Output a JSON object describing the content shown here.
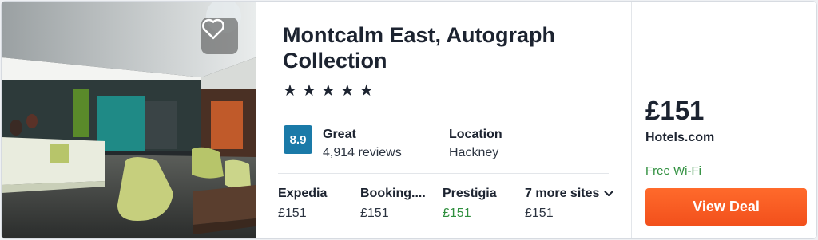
{
  "hotel": {
    "name": "Montcalm East, Autograph Collection",
    "star_count": 5,
    "star_glyph": "★",
    "rating_score": "8.9",
    "rating_label": "Great",
    "reviews": "4,914 reviews",
    "location_label": "Location",
    "location": "Hackney"
  },
  "sites": [
    {
      "name": "Expedia",
      "price": "£151",
      "highlight": false
    },
    {
      "name": "Booking....",
      "price": "£151",
      "highlight": false
    },
    {
      "name": "Prestigia",
      "price": "£151",
      "highlight": true
    },
    {
      "name": "7 more sites",
      "price": "£151",
      "highlight": false
    }
  ],
  "deal": {
    "price": "£151",
    "provider": "Hotels.com",
    "amenity": "Free Wi-Fi",
    "button_label": "View Deal"
  },
  "icons": {
    "favorite": "heart-outline-icon",
    "expand": "chevron-down-icon"
  },
  "colors": {
    "score_badge": "#1a7aa8",
    "deal_button": "#f2501c",
    "positive_text": "#2f8f3e"
  }
}
